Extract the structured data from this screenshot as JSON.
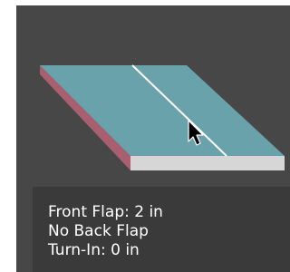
{
  "viewport": {
    "colors": {
      "background": "#474747",
      "panel": "#3a3a3a",
      "top_face": "#6aa2ac",
      "left_edge": "#a86070",
      "front_edge": "#d6d6d6",
      "fold_line": "#ffffff"
    },
    "cursor_icon": "arrow-pointer-icon"
  },
  "info": {
    "front_flap": "Front Flap: 2 in",
    "back_flap": "No Back Flap",
    "turn_in": "Turn-In: 0 in"
  }
}
